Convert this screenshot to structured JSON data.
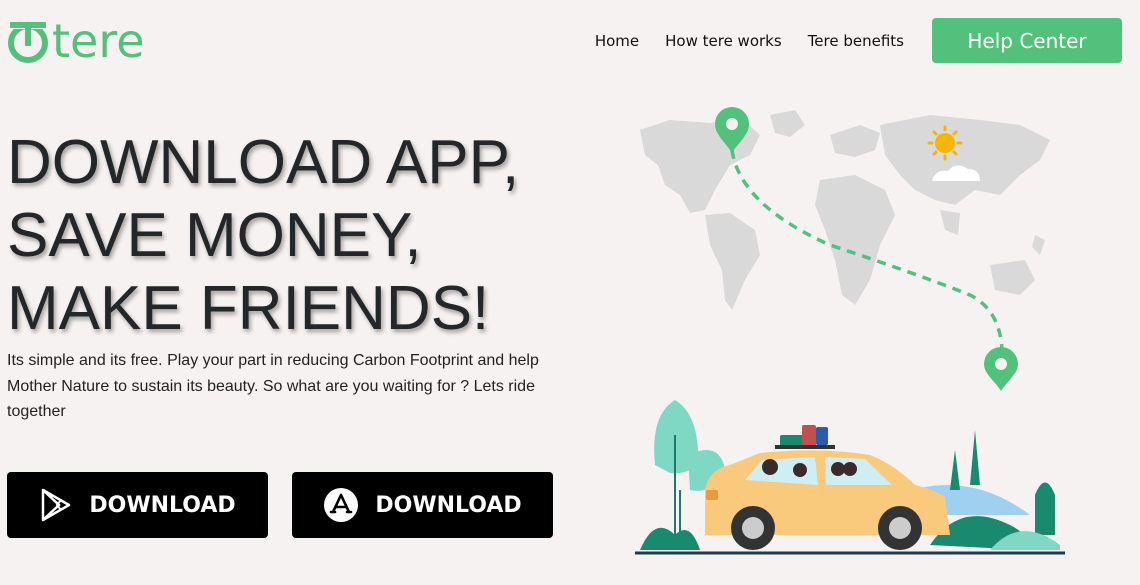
{
  "brand": {
    "name": "tere",
    "color": "#52c17c"
  },
  "nav": {
    "items": [
      "Home",
      "How tere works",
      "Tere benefits"
    ],
    "help_label": "Help Center"
  },
  "hero": {
    "headline": [
      "DOWNLOAD APP,",
      "SAVE MONEY,",
      "MAKE FRIENDS!"
    ],
    "description": "Its simple and its free. Play your part in reducing Carbon Footprint and help Mother Nature to sustain its beauty. So what are you waiting for ? Lets ride together"
  },
  "downloads": {
    "play_label": "DOWNLOAD",
    "apple_label": "DOWNLOAD",
    "play_icon": "google-play-icon",
    "apple_icon": "app-store-icon"
  },
  "colors": {
    "background": "#f6f2f1",
    "accent": "#52c17c",
    "button": "#000000",
    "car": "#f9c97c"
  }
}
